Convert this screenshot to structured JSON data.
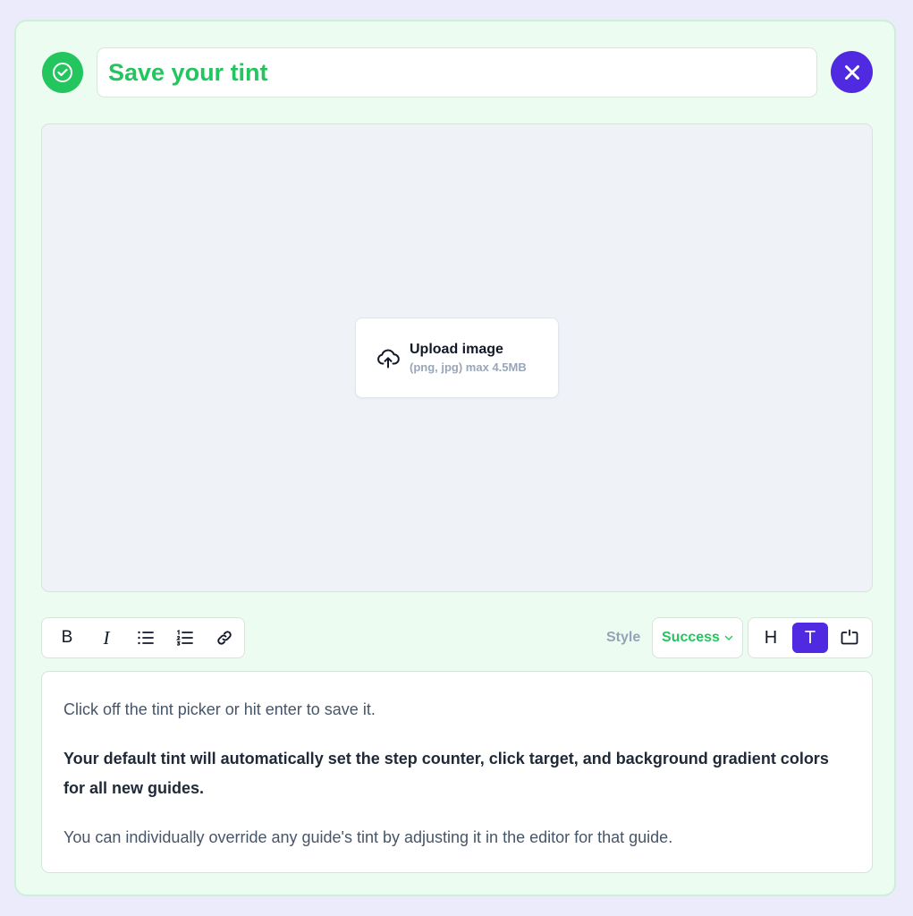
{
  "dialog": {
    "title": "Save your tint",
    "icons": {
      "status": "check-circle-icon",
      "close": "close-icon"
    },
    "colors": {
      "accent": "#22c55e",
      "primary": "#4f2ae0",
      "card_background": "#edfcf1",
      "page_background": "#ecebfb"
    }
  },
  "upload": {
    "label": "Upload image",
    "hint": "(png, jpg) max 4.5MB",
    "icon": "cloud-upload-icon"
  },
  "toolbar": {
    "format_buttons": [
      {
        "name": "bold",
        "glyph": "B"
      },
      {
        "name": "italic",
        "glyph": "I"
      },
      {
        "name": "bullet-list",
        "icon": "bullet-list-icon"
      },
      {
        "name": "numbered-list",
        "icon": "numbered-list-icon"
      },
      {
        "name": "link",
        "icon": "link-icon"
      }
    ],
    "style_label": "Style",
    "style_value": "Success",
    "mode_buttons": [
      {
        "name": "heading",
        "glyph": "H",
        "active": false
      },
      {
        "name": "text",
        "glyph": "T",
        "active": true
      },
      {
        "name": "button-block",
        "icon": "button-block-icon",
        "active": false
      }
    ]
  },
  "body": {
    "paragraph1": "Click off the tint picker or hit enter to save it.",
    "paragraph2": "Your default tint will automatically set the step counter, click target, and background gradient colors for all new guides.",
    "paragraph3": "You can individually override any guide's tint by adjusting it in the editor for that guide."
  }
}
